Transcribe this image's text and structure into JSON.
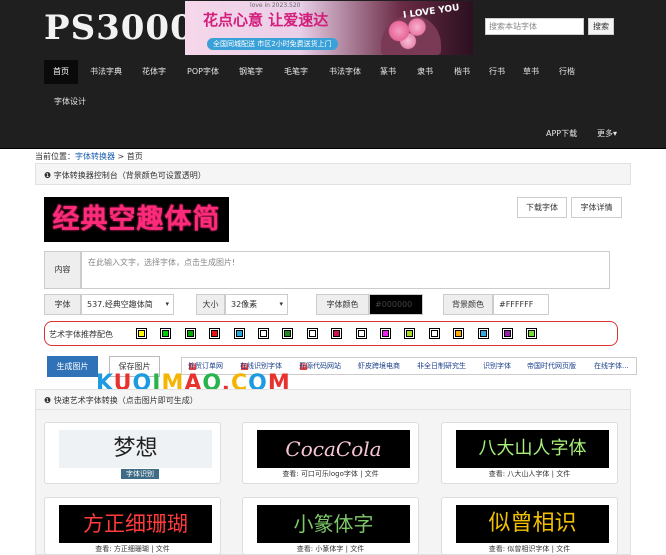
{
  "site": {
    "logo": "PS3000"
  },
  "banner": {
    "line1": "花点心意 让爱速达",
    "small": "love in 2023.520",
    "tag": "全国同城配送 市区2小时免费送货上门",
    "corner": "I LOVE YOU"
  },
  "search": {
    "placeholder": "搜索本站字体",
    "button": "搜索"
  },
  "nav": [
    "首页",
    "书法字典",
    "花体字",
    "POP字体",
    "钢笔字",
    "毛笔字",
    "书法字体",
    "篆书",
    "隶书",
    "楷书",
    "行书",
    "草书",
    "行楷",
    "字体设计"
  ],
  "nav_right": {
    "app": "APP下载",
    "more": "更多▾"
  },
  "breadcrumb": {
    "prefix": "当前位置：",
    "link": "字体转换器",
    "sep": " > ",
    "current": "首页"
  },
  "console": {
    "title": "❶ 字体转换器控制台（背景颜色可设置透明）",
    "preview_text": "经典空趣体简",
    "download_btn": "下载字体",
    "detail_btn": "字体详情",
    "content_label": "内容",
    "content_placeholder": "在此输入文字，选择字体，点击生成图片!",
    "font_label": "字体",
    "font_value": "537.经典空趣体简",
    "size_label": "大小",
    "size_value": "32像素",
    "fcolor_label": "字体颜色",
    "fcolor_value": "#000000",
    "bgcolor_label": "背景颜色",
    "bgcolor_value": "#FFFFFF",
    "palette_label": "艺术字体推荐配色",
    "palette": [
      {
        "outer": "#000000",
        "inner": "#ffff00"
      },
      {
        "outer": "#000000",
        "inner": "#00cc00"
      },
      {
        "outer": "#000000",
        "inner": "#00aa00"
      },
      {
        "outer": "#000000",
        "inner": "#ee1111"
      },
      {
        "outer": "#000000",
        "inner": "#22aadd"
      },
      {
        "outer": "#000000",
        "inner": "#ffffff"
      },
      {
        "outer": "#000000",
        "inner": "#228822"
      },
      {
        "outer": "#000000",
        "inner": "#ffffff"
      },
      {
        "outer": "#000000",
        "inner": "#cc1155"
      },
      {
        "outer": "#000000",
        "inner": "#ffffff"
      },
      {
        "outer": "#000000",
        "inner": "#ee22ee"
      },
      {
        "outer": "#000000",
        "inner": "#aadd22"
      },
      {
        "outer": "#000000",
        "inner": "#ffffff"
      },
      {
        "outer": "#000000",
        "inner": "#ffaa00"
      },
      {
        "outer": "#000000",
        "inner": "#33aadd"
      },
      {
        "outer": "#000000",
        "inner": "#9922aa"
      },
      {
        "outer": "#000000",
        "inner": "#77dd33"
      }
    ],
    "generate_btn": "生成图片",
    "save_btn": "保存图片",
    "links": [
      "外贸订单网",
      "在线识别字体",
      "开源代码网站",
      "虾皮跨境电商",
      "非全日制研究生",
      "识别字体",
      "帝国时代网页版",
      "在线字体..."
    ]
  },
  "watermark": "KUQIMAO.COM",
  "quick": {
    "title": "❶ 快速艺术字体转换（点击图片即可生成）",
    "cards": [
      {
        "text": "梦想",
        "caption": "字体识别",
        "color": "#222222",
        "bg": "#dfe6ea"
      },
      {
        "text": "CocaCola",
        "caption": "查看: 可口可乐logo字体 | 文件",
        "color": "#f7c6d6",
        "bg": "#000000"
      },
      {
        "text": "八大山人字体",
        "caption": "查看: 八大山人字体 | 文件",
        "color": "#a8f07a",
        "bg": "#000000"
      },
      {
        "text": "方正细珊瑚",
        "caption": "查看: 方正细珊瑚 | 文件",
        "color": "#ff3b3b",
        "bg": "#000000"
      },
      {
        "text": "小篆体字",
        "caption": "查看: 小篆体字 | 文件",
        "color": "#7ec86a",
        "bg": "#000000"
      },
      {
        "text": "似曾相识",
        "caption": "查看: 似曾相识字体 | 文件",
        "color": "#f2c000",
        "bg": "#000000"
      }
    ]
  },
  "colors": {
    "header": "#1f1f1f",
    "accent": "#2f72b8",
    "preview_fg": "#ff2a7a",
    "palette_border": "#dd3333"
  }
}
